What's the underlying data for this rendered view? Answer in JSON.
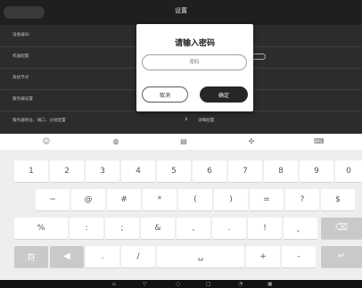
{
  "topbar": {
    "back_label": "",
    "title": "设置"
  },
  "settings_rows": [
    {
      "label": "设备编号: ",
      "value": ""
    },
    {
      "label": "机器配置",
      "value": ""
    },
    {
      "label": "系统节点",
      "value": ""
    },
    {
      "label": "服务器设置",
      "value": ""
    },
    {
      "label": "服务器地址、端口、分组配置",
      "value": "详细配置"
    }
  ],
  "dialog": {
    "title": "请输入密码",
    "password_placeholder": "密码",
    "cancel_label": "取消",
    "confirm_label": "确定"
  },
  "keyboard": {
    "toolbar_icons": [
      "emoji-icon",
      "globe-icon",
      "clipboard-icon",
      "cursor-move-icon",
      "keyboard-hide-icon"
    ],
    "row1": [
      "1",
      "2",
      "3",
      "4",
      "5",
      "6",
      "7",
      "8",
      "9",
      "0"
    ],
    "row2": [
      "~",
      "@",
      "#",
      "*",
      "(",
      ")",
      "=",
      "?",
      "$"
    ],
    "row3": [
      "%",
      ":",
      ";",
      "&",
      ",",
      ".",
      "!",
      "、"
    ],
    "row4": {
      "switch_label": "符",
      "dot": ".",
      "slash": "/",
      "plus": "+",
      "minus": "-"
    }
  },
  "colors": {
    "dialog_confirm_bg": "#262626",
    "keyboard_bg": "#eeeeee",
    "gray_key": "#c9c9c9",
    "topbar_bg": "#1f1f1f"
  }
}
